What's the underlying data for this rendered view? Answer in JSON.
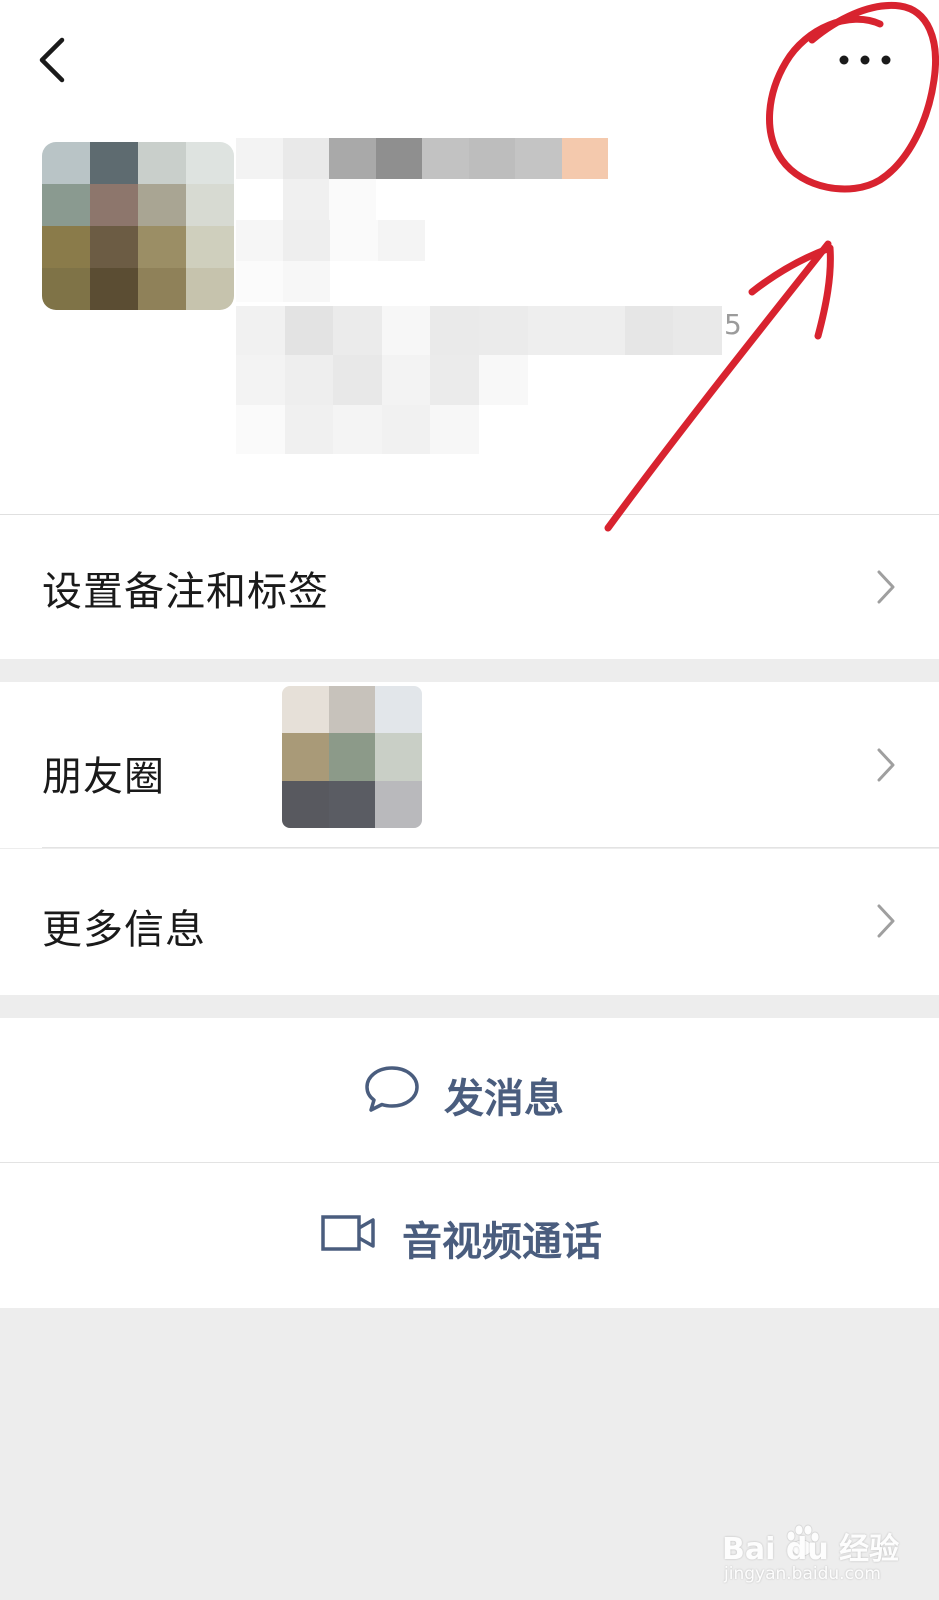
{
  "header": {
    "back_icon": "chevron-left-icon",
    "more_icon": "ellipsis-icon"
  },
  "profile": {
    "stray_digit": "5"
  },
  "menu": {
    "remark_tags_label": "设置备注和标签",
    "moments_label": "朋友圈",
    "more_info_label": "更多信息",
    "chevron_icon": "chevron-right-icon"
  },
  "actions": {
    "send_message_label": "发消息",
    "send_message_icon": "chat-bubble-icon",
    "video_call_label": "音视频通话",
    "video_call_icon": "video-camera-icon"
  },
  "watermark": {
    "brand": "Bai du 经验",
    "url": "jingyan.baidu.com"
  },
  "colors": {
    "accent_text": "#4a5d7e",
    "annotation": "#d8232f",
    "page_background": "#ededed"
  }
}
